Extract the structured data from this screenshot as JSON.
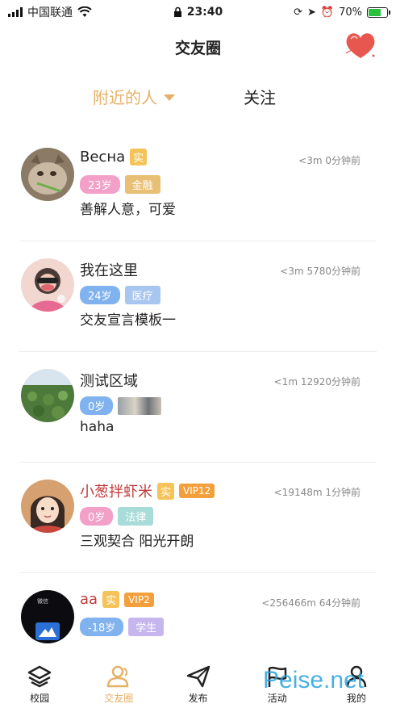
{
  "status_bar": {
    "carrier": "中国联通",
    "time": "23:40",
    "battery": "70%",
    "battery_level": 0.7
  },
  "header": {
    "title": "交友圈"
  },
  "tabs": {
    "nearby": "附近的人",
    "follow": "关注"
  },
  "people": [
    {
      "name": "Весна",
      "real": "实",
      "vip": "",
      "meta": "<3m  0分钟前",
      "age": "23岁",
      "age_color": "pink",
      "job": "金融",
      "job_color": "gold",
      "desc": "善解人意，可爱"
    },
    {
      "name": "我在这里",
      "real": "",
      "vip": "",
      "meta": "<3m  5780分钟前",
      "age": "24岁",
      "age_color": "blue",
      "job": "医疗",
      "job_color": "lblue",
      "desc": "交友宣言模板一"
    },
    {
      "name": "测试区域",
      "real": "",
      "vip": "",
      "meta": "<1m  12920分钟前",
      "age": "0岁",
      "age_color": "blue",
      "job": "",
      "job_color": "",
      "desc": "haha"
    },
    {
      "name": "小葱拌虾米",
      "real": "实",
      "vip": "VIP12",
      "meta": "<19148m  1分钟前",
      "age": "0岁",
      "age_color": "pink",
      "job": "法律",
      "job_color": "teal",
      "desc": "三观契合 阳光开朗"
    },
    {
      "name": "aa",
      "real": "实",
      "vip": "VIP2",
      "meta": "<256466m  64分钟前",
      "age": "-18岁",
      "age_color": "blue",
      "job": "学生",
      "job_color": "purple",
      "desc": ""
    }
  ],
  "nav": {
    "campus": "校园",
    "circle": "交友圈",
    "publish": "发布",
    "activity": "活动",
    "mine": "我的"
  },
  "avatar_label_5": "微信",
  "watermark": "Peise.net",
  "colors": {
    "accent": "#e5b167",
    "vip_name": "#c23a3a"
  }
}
